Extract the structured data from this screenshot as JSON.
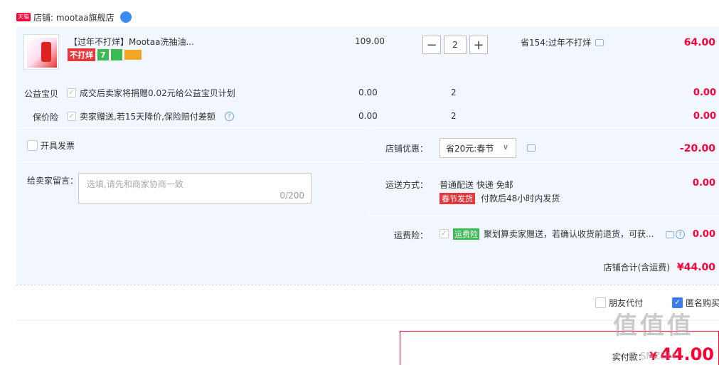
{
  "shop": {
    "badge": "天猫",
    "label": "店铺: mootaa旗舰店"
  },
  "item": {
    "title": "【过年不打烊】Mootaa洗抽油...",
    "tag_label": "不打烊",
    "tag_badge_7": "7",
    "unit_price": "109.00",
    "quantity": "2",
    "promo": "省154:过年不打烊",
    "subtotal": "64.00"
  },
  "charity": {
    "label": "公益宝贝",
    "desc": "成交后卖家将捐赠0.02元给公益宝贝计划",
    "price": "0.00",
    "qty": "2",
    "total": "0.00"
  },
  "price_protect": {
    "label": "保价险",
    "desc": "卖家赠送,若15天降价,保险赔付差额",
    "price": "0.00",
    "qty": "2",
    "total": "0.00"
  },
  "invoice": {
    "label": "开具发票"
  },
  "message": {
    "label": "给卖家留言：",
    "placeholder": "选填,请先和商家协商一致",
    "counter": "0/200"
  },
  "shop_discount": {
    "label": "店铺优惠：",
    "selected": "省20元:春节",
    "amount": "-20.00"
  },
  "shipping": {
    "label": "运送方式：",
    "method": "普通配送 快递 免邮",
    "badge": "春节发货",
    "note": "付款后48小时内发货",
    "amount": "0.00"
  },
  "freight_insurance": {
    "label": "运费险：",
    "badge": "运费险",
    "desc": "聚划算卖家赠送，若确认收货前退货，可获...",
    "amount": "0.00"
  },
  "shop_total": {
    "label": "店铺合计(含运费)",
    "amount": "¥44.00"
  },
  "options": {
    "friend_pay": "朋友代付",
    "anonymous": "匿名购买"
  },
  "final": {
    "label": "实付款：",
    "currency": "¥",
    "amount": "44.00"
  },
  "watermark": "值 值 值",
  "watermark_sub": "zhi  值  SMZDM"
}
